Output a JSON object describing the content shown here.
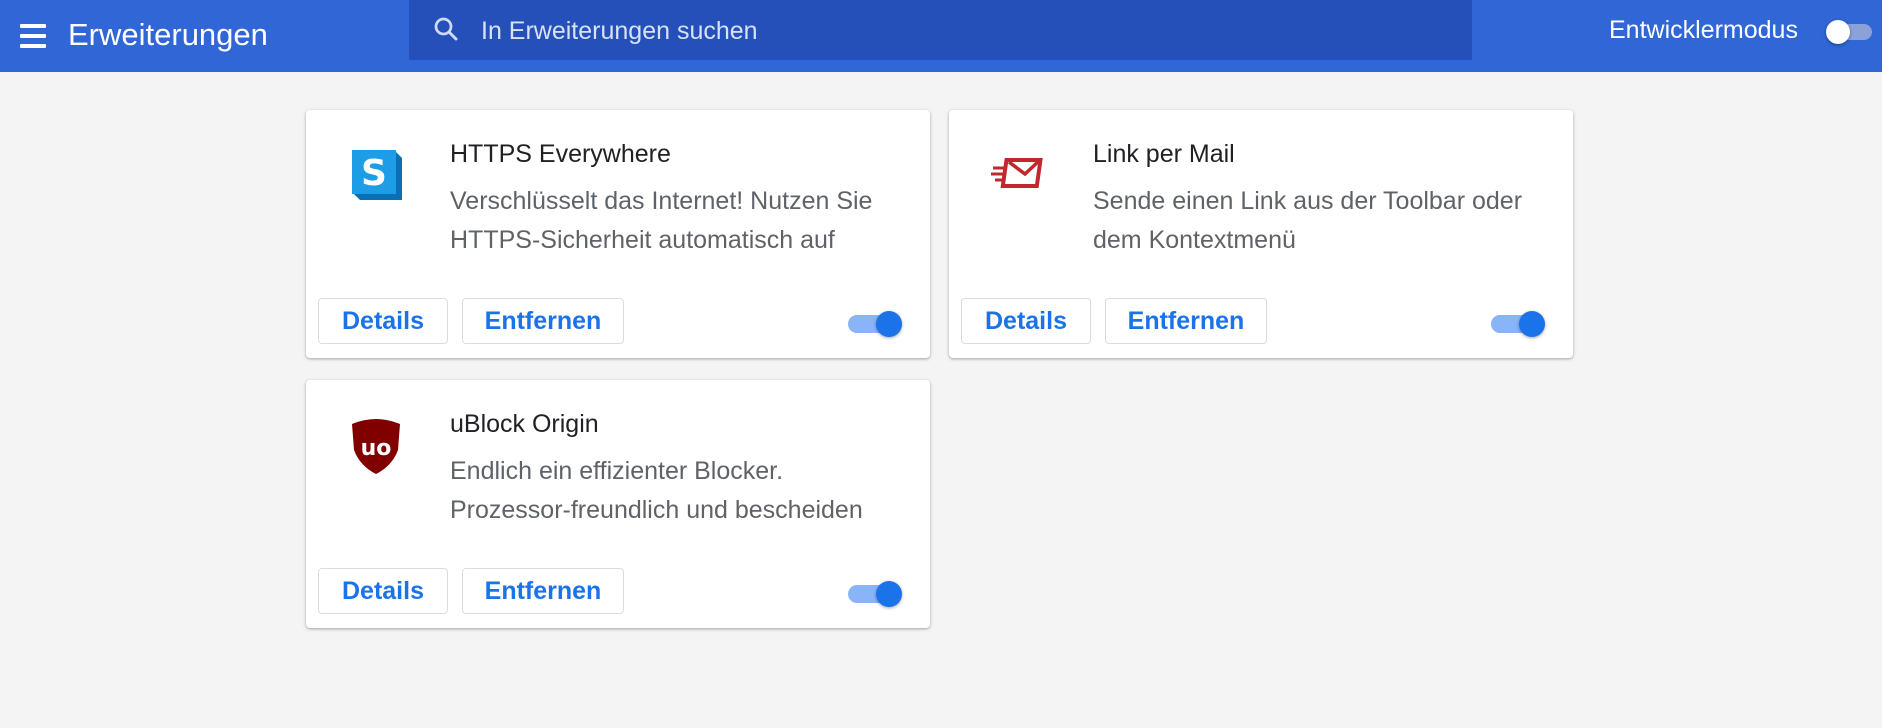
{
  "header": {
    "title": "Erweiterungen",
    "search_placeholder": "In Erweiterungen suchen",
    "dev_mode_label": "Entwicklermodus",
    "dev_mode_enabled": false,
    "brand_color": "#3066d6"
  },
  "extensions": [
    {
      "name": "HTTPS Everywhere",
      "description": "Verschlüsselt das Internet! Nutzen Sie HTTPS-Sicherheit automatisch auf",
      "icon": "https-everywhere-icon",
      "details_label": "Details",
      "remove_label": "Entfernen",
      "enabled": true
    },
    {
      "name": "Link per Mail",
      "description": "Sende einen Link aus der Toolbar oder dem Kontextmenü",
      "icon": "mail-icon",
      "details_label": "Details",
      "remove_label": "Entfernen",
      "enabled": true
    },
    {
      "name": "uBlock Origin",
      "description": "Endlich ein effizienter Blocker. Prozessor-freundlich und bescheiden",
      "icon": "ublock-origin-icon",
      "details_label": "Details",
      "remove_label": "Entfernen",
      "enabled": true
    }
  ]
}
